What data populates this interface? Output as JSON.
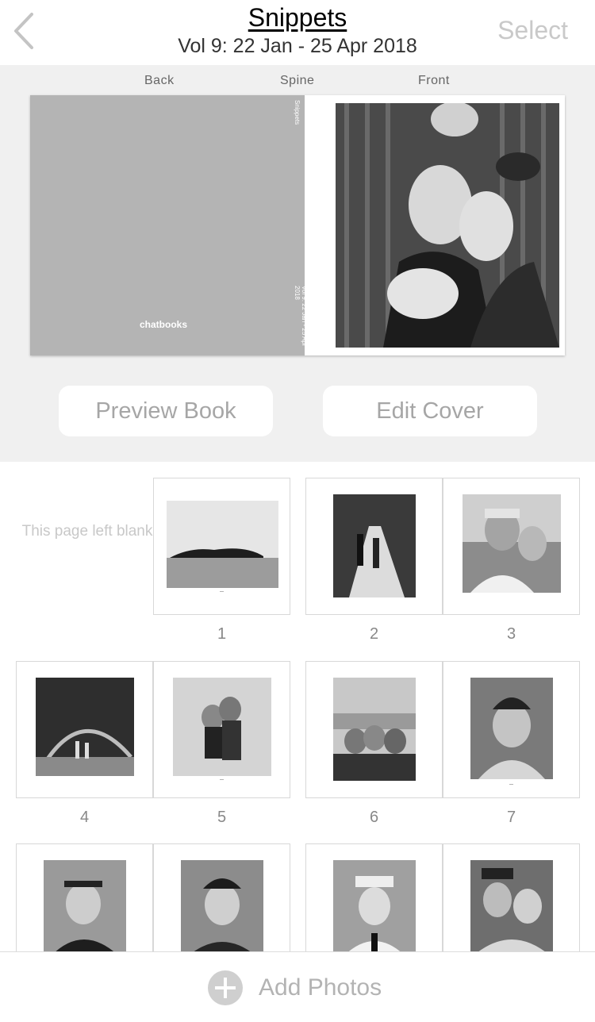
{
  "header": {
    "title": "Snippets",
    "subtitle": "Vol 9: 22 Jan - 25 Apr 2018",
    "select_label": "Select"
  },
  "cover": {
    "back_label": "Back",
    "spine_label": "Spine",
    "front_label": "Front",
    "logo_text": "chatbooks",
    "spine_title": "Snippets",
    "spine_volume": "Vol 9: 22 Jan - 25 Apr 2018"
  },
  "actions": {
    "preview_label": "Preview Book",
    "edit_cover_label": "Edit Cover"
  },
  "pages": {
    "blank_note": "This page left blank",
    "numbers": [
      "1",
      "2",
      "3",
      "4",
      "5",
      "6",
      "7"
    ]
  },
  "bottom": {
    "add_photos_label": "Add Photos"
  },
  "colors": {
    "cover_back": "#b4b4b4",
    "section_bg": "#f0f0f0",
    "muted_text": "#a6a6a6"
  }
}
